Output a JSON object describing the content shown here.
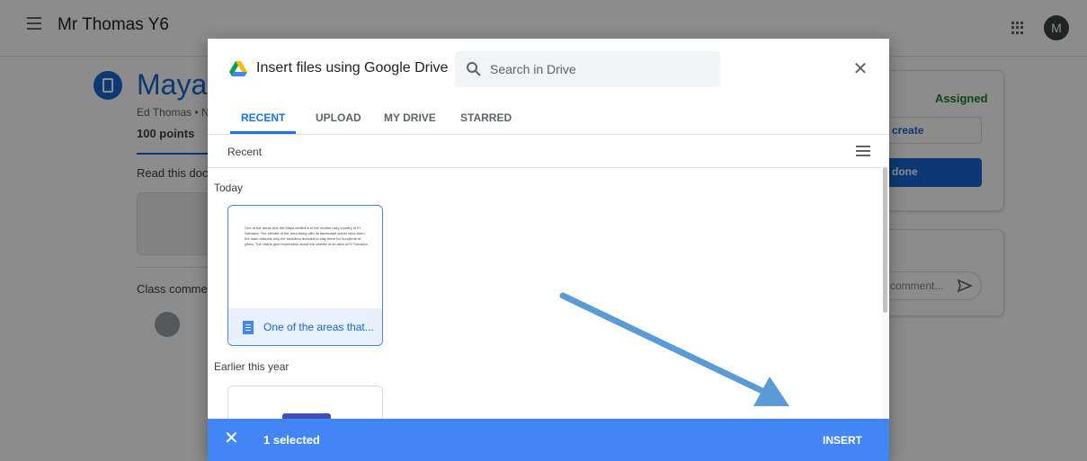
{
  "header": {
    "class_name": "Mr Thomas Y6",
    "avatar_initial": "M"
  },
  "assignment": {
    "title": "Maya",
    "meta": "Ed Thomas • N",
    "points": "100 points",
    "description": "Read this doc",
    "comments_label": "Class comme"
  },
  "side_panel": {
    "status": "Assigned",
    "create_label": "create",
    "done_label": "done",
    "comment_placeholder": "comment..."
  },
  "dialog": {
    "title": "Insert files using Google Drive",
    "search_placeholder": "Search in Drive",
    "tabs": [
      {
        "label": "RECENT",
        "active": true
      },
      {
        "label": "UPLOAD",
        "active": false
      },
      {
        "label": "MY DRIVE",
        "active": false
      },
      {
        "label": "STARRED",
        "active": false
      }
    ],
    "section_header": "Recent",
    "groups": {
      "today": "Today",
      "earlier": "Earlier this year"
    },
    "files": [
      {
        "name": "One of the areas that...",
        "selected": true,
        "preview_text": "One of the areas that the Maya settled is in the modern-day country of El Salvador. The climate of the area along with its landscape would have been the main reasons why the travellers decided to stay there for hundreds of years. The charts give information about the climate of an area of El Salvador."
      }
    ],
    "selection_bar": {
      "count_label": "1 selected",
      "insert_label": "INSERT",
      "color": "#4285f4"
    }
  },
  "colors": {
    "accent": "#1967d2",
    "status_green": "#188038",
    "annotation_arrow": "#5b9bd5"
  }
}
